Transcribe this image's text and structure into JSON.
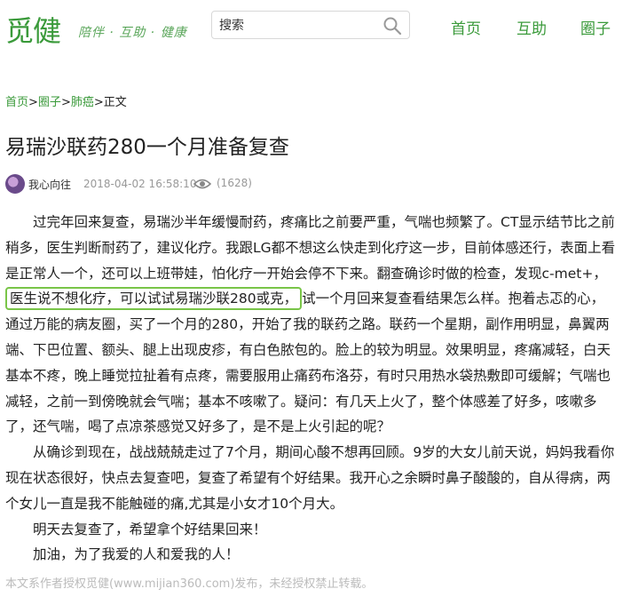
{
  "header": {
    "logo": "觅健",
    "slogan": "陪伴 · 互助 · 健康",
    "search_placeholder": "搜索",
    "nav": [
      "首页",
      "互助",
      "圈子"
    ]
  },
  "breadcrumb": [
    "首页",
    "圈子",
    "肺癌",
    "正文"
  ],
  "article": {
    "title": "易瑞沙联药280一个月准备复查",
    "author": "我心向往",
    "date": "2018-04-02 16:58:10",
    "views": "(1628)",
    "p1_before": "过完年回来复查，易瑞沙半年缓慢耐药，疼痛比之前要严重，气喘也频繁了。CT显示结节比之前稍多，医生判断耐药了，建议化疗。我跟LG都不想这么快走到化疗这一步，目前体感还行，表面上看是正常人一个，还可以上班带娃，怕化疗一开始会停不下来。翻查确诊时做的检查，发现c-met+，",
    "p1_highlight": "医生说不想化疗，可以试试易瑞沙联280或克，",
    "p1_after": "试一个月回来复查看结果怎么样。抱着忐忑的心，通过万能的病友圈，买了一个月的280，开始了我的联药之路。联药一个星期，副作用明显，鼻翼两端、下巴位置、额头、腿上出现皮疹，有白色脓包的。脸上的较为明显。效果明显，疼痛减轻，白天基本不疼，晚上睡觉拉扯着有点疼，需要服用止痛药布洛芬，有时只用热水袋热敷即可缓解；气喘也减轻，之前一到傍晚就会气喘；基本不咳嗽了。疑问：有几天上火了，整个体感差了好多，咳嗽多了，还气喘，喝了点凉茶感觉又好多了，是不是上火引起的呢？",
    "p2": "从确诊到现在，战战兢兢走过了7个月，期间心酸不想再回顾。9岁的大女儿前天说，妈妈我看你现在状态很好，快点去复查吧，复查了希望有个好结果。我开心之余瞬时鼻子酸酸的，自从得病，两个女儿一直是我不能触碰的痛,尤其是小女才10个月大。",
    "p3": "明天去复查了，希望拿个好结果回来！",
    "p4": "加油，为了我爱的人和爱我的人！"
  },
  "footer_note": "本文系作者授权觅健(www.mijian360.com)发布，未经授权禁止转载。",
  "colors": {
    "brand_green": "#3a9a3a",
    "highlight_border": "#79c548"
  }
}
